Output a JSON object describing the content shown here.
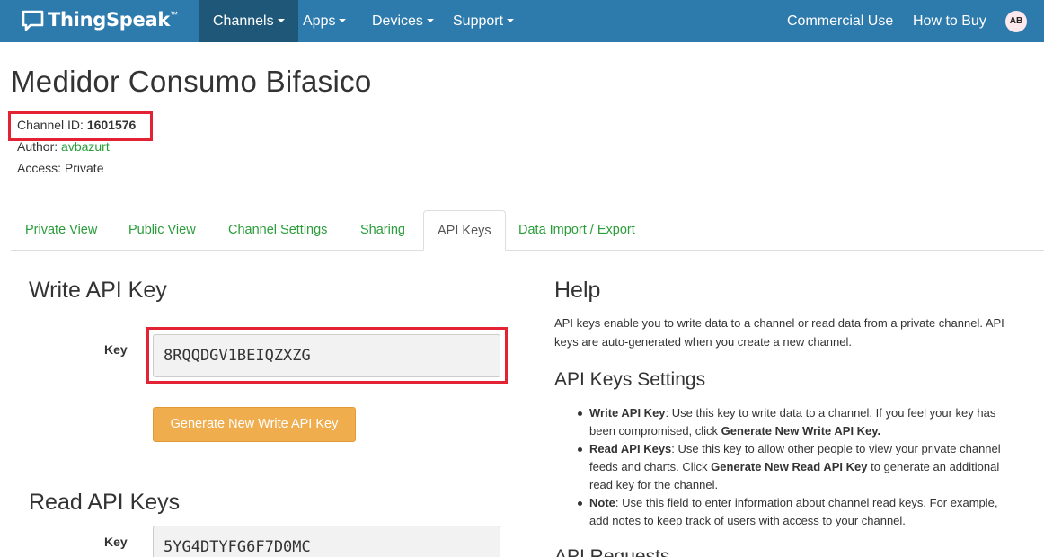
{
  "navbar": {
    "brand": "ThingSpeak",
    "brand_tm": "™",
    "items": {
      "channels": "Channels",
      "apps": "Apps",
      "devices": "Devices",
      "support": "Support",
      "commercial": "Commercial Use",
      "how_to_buy": "How to Buy"
    },
    "avatar": "AB",
    "color": "#2d7aad",
    "active_color": "#1f5778"
  },
  "channel": {
    "title": "Medidor Consumo Bifasico",
    "id_label": "Channel ID: ",
    "id_value": "1601576",
    "author_label": "Author: ",
    "author_value": "avbazurt",
    "access_label": "Access: ",
    "access_value": "Private"
  },
  "tabs": [
    "Private View",
    "Public View",
    "Channel Settings",
    "Sharing",
    "API Keys",
    "Data Import / Export"
  ],
  "active_tab": "API Keys",
  "write_key": {
    "title": "Write API Key",
    "label": "Key",
    "value": "8RQQDGV1BEIQZXZG",
    "button": "Generate New Write API Key"
  },
  "read_keys": {
    "title": "Read API Keys",
    "label": "Key",
    "value": "5YG4DTYFG6F7D0MC"
  },
  "help": {
    "title": "Help",
    "intro": "API keys enable you to write data to a channel or read data from a private channel. API keys are auto-generated when you create a new channel.",
    "settings_title": "API Keys Settings",
    "items": [
      {
        "bold": "Write API Key",
        "text1": ": Use this key to write data to a channel. If you feel your key has been compromised, click ",
        "bold2": "Generate New Write API Key.",
        "text2": ""
      },
      {
        "bold": "Read API Keys",
        "text1": ": Use this key to allow other people to view your private channel feeds and charts. Click ",
        "bold2": "Generate New Read API Key",
        "text2": " to generate an additional read key for the channel."
      },
      {
        "bold": "Note",
        "text1": ": Use this field to enter information about channel read keys. For example, add notes to keep track of users with access to your channel.",
        "bold2": "",
        "text2": ""
      }
    ],
    "next_title": "API Requests"
  },
  "colors": {
    "highlight": "#e32333",
    "link_green": "#2a9d3a",
    "button_orange": "#f0ad4e"
  }
}
